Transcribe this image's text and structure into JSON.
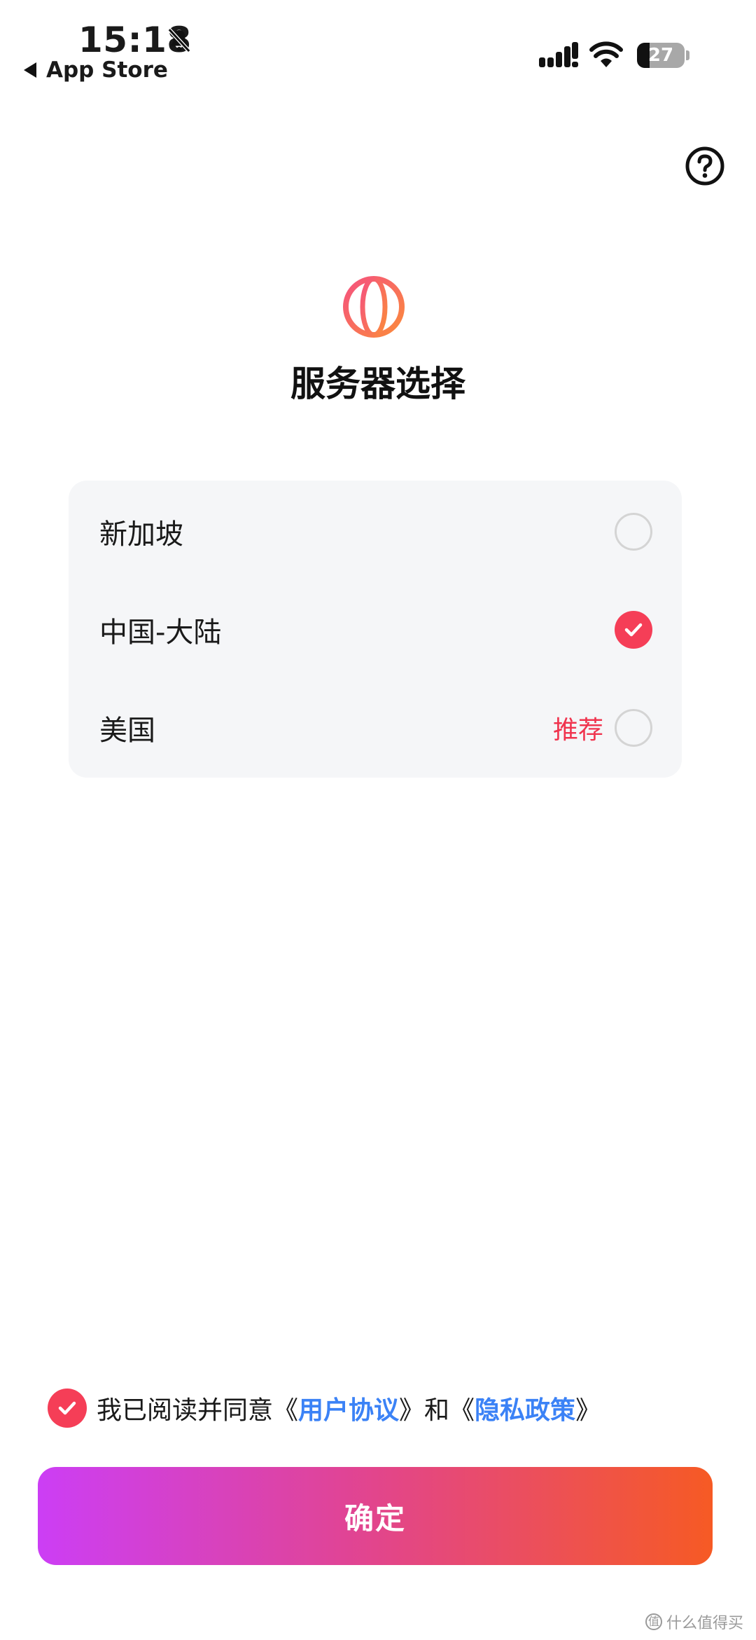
{
  "status_bar": {
    "time": "15:18",
    "back_label": "App Store",
    "battery_percent": "27",
    "battery_level": 0.27,
    "icons": [
      "bell-slash-icon",
      "cellular-signal-icon",
      "wifi-icon",
      "battery-icon"
    ]
  },
  "header": {
    "help_icon": "question-circle-icon",
    "logo_icon": "globe-icon",
    "title": "服务器选择"
  },
  "servers": [
    {
      "name": "新加坡",
      "recommend": "",
      "selected": false
    },
    {
      "name": "中国-大陆",
      "recommend": "",
      "selected": true
    },
    {
      "name": "美国",
      "recommend": "推荐",
      "selected": false
    }
  ],
  "agreement": {
    "checked": true,
    "prefix": "我已阅读并同意《",
    "user_agreement": "用户协议",
    "middle": "》和《",
    "privacy_policy": "隐私政策",
    "suffix": "》"
  },
  "confirm_label": "确定",
  "watermark": "什么值得买",
  "colors": {
    "accent_red": "#f53e57",
    "link_blue": "#3b82f6",
    "gradient_start": "#cc3ef5",
    "gradient_end": "#f65a24"
  }
}
